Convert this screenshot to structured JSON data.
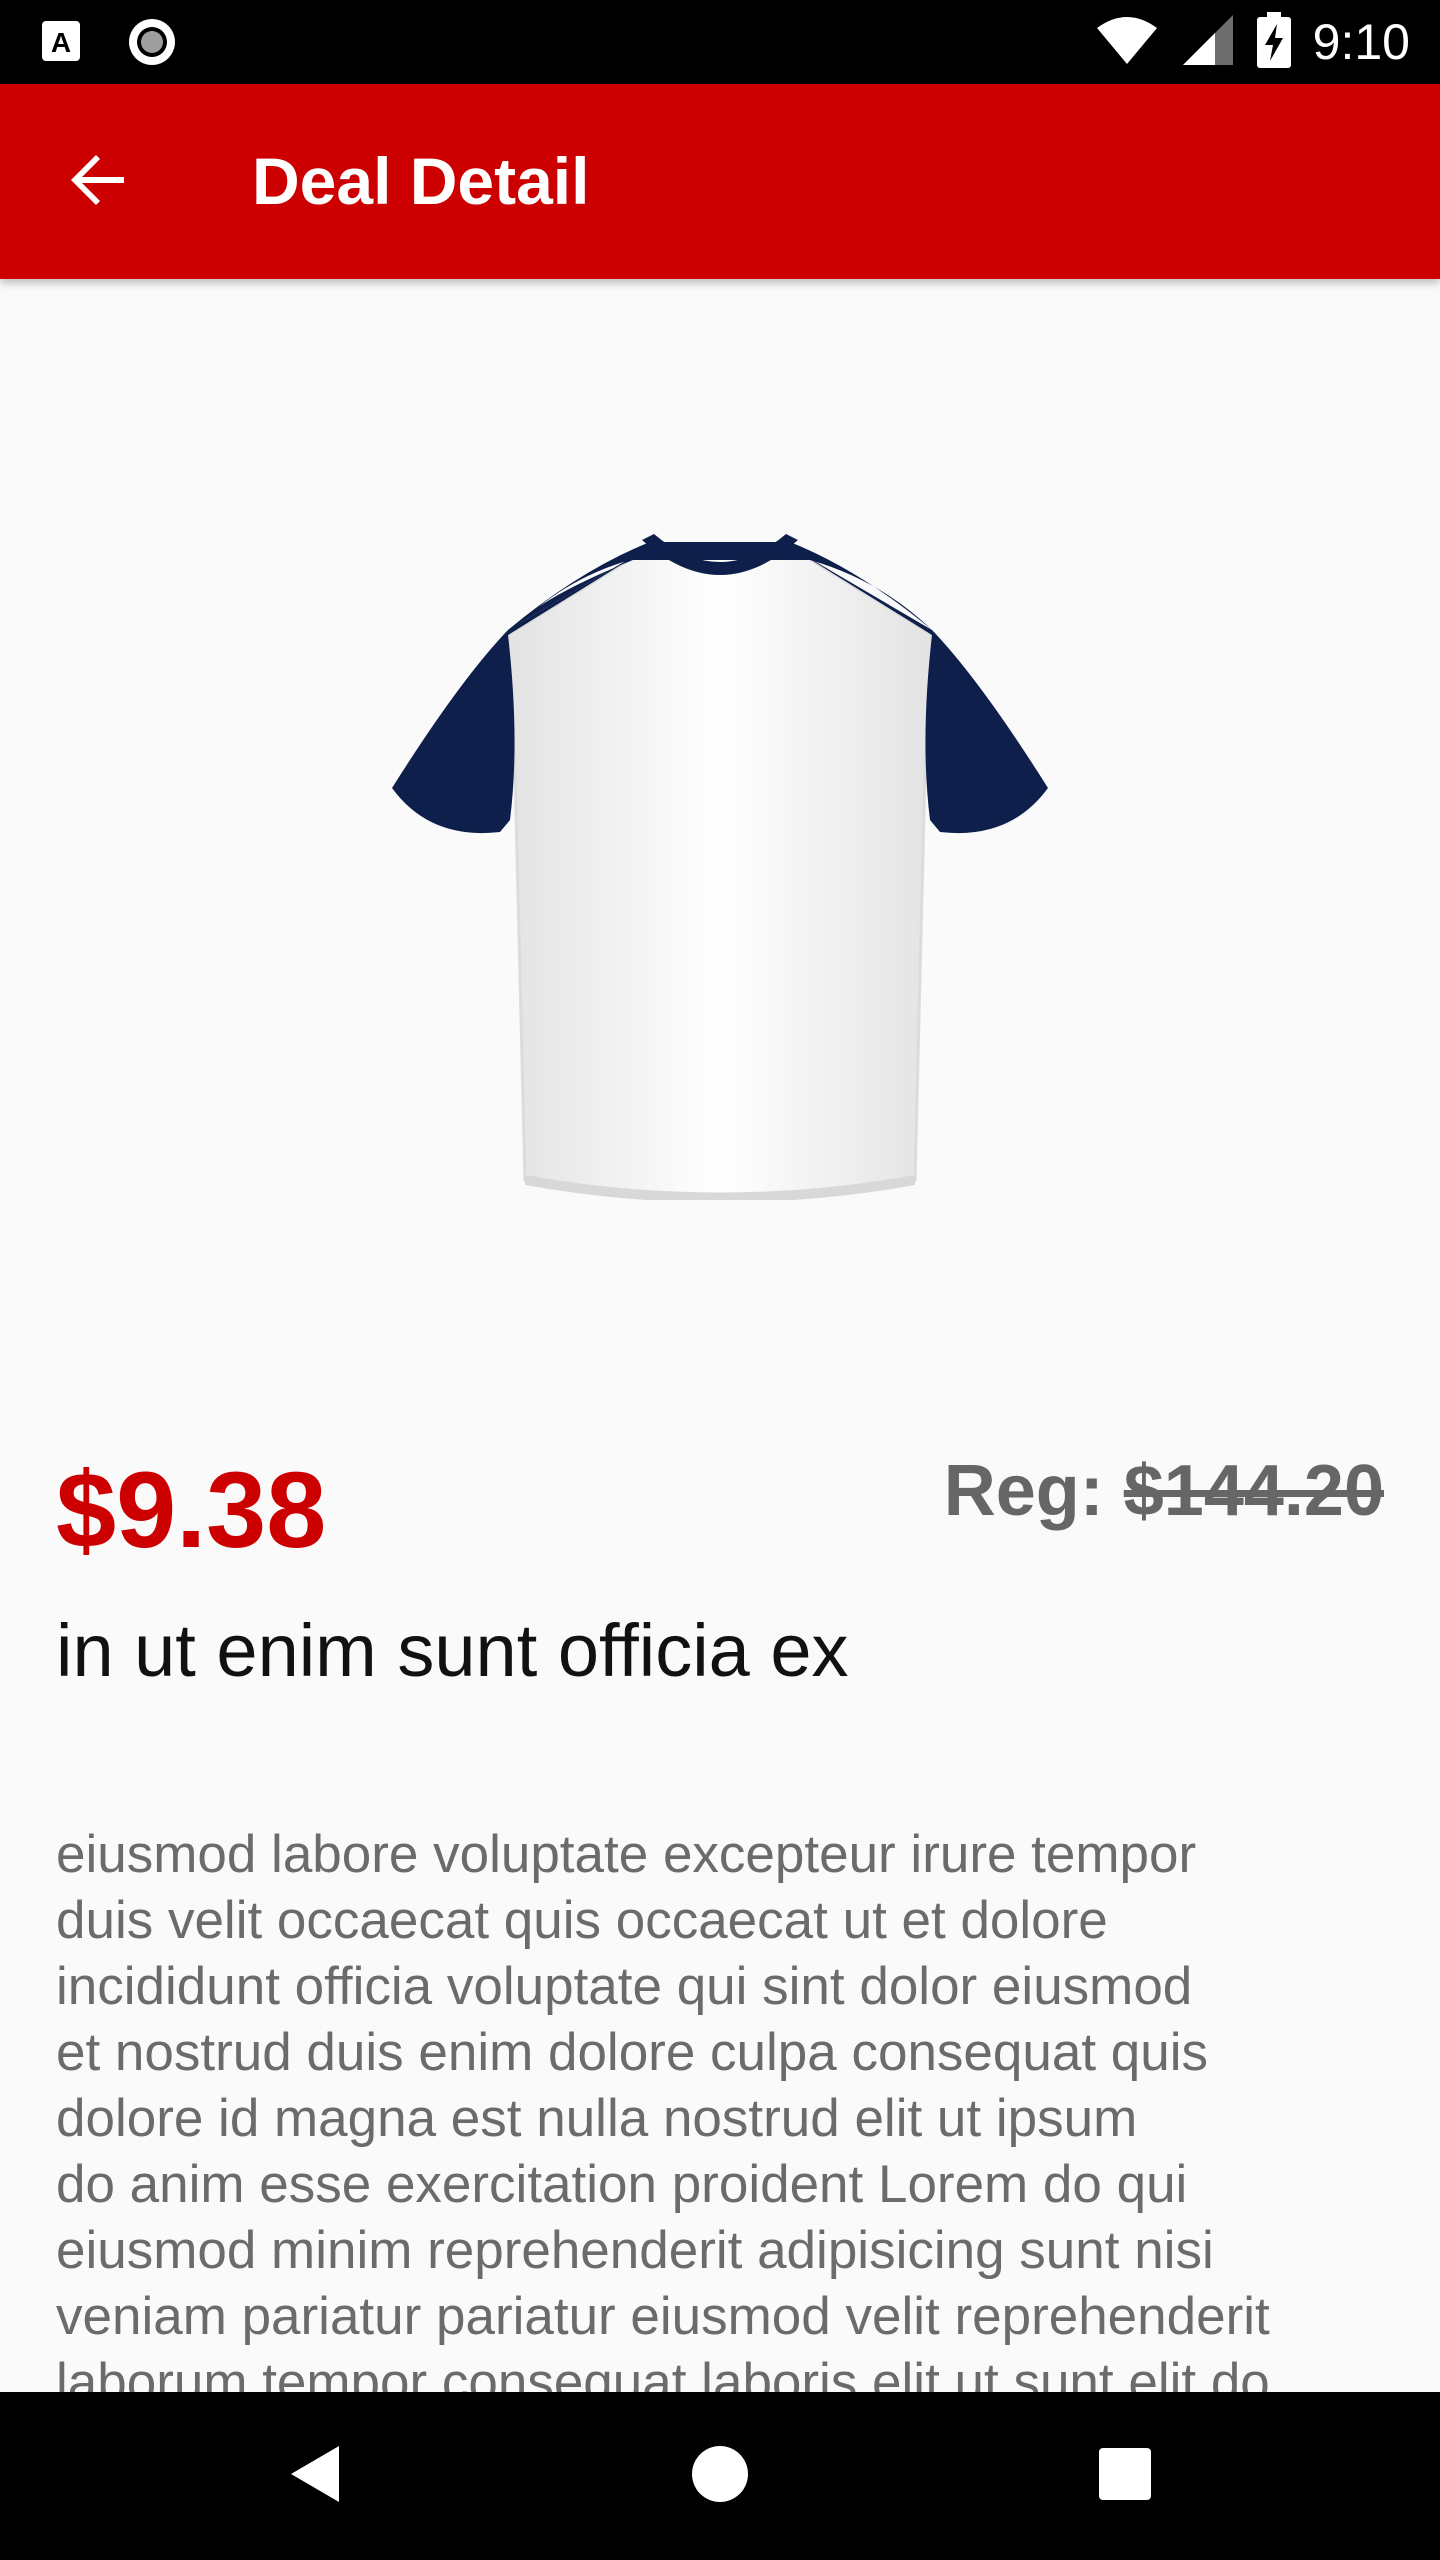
{
  "status_bar": {
    "time": "9:10",
    "icons": [
      "a-notification-icon",
      "circle-notification-icon",
      "wifi-icon",
      "cell-signal-icon",
      "battery-charging-icon"
    ]
  },
  "app_bar": {
    "title": "Deal Detail",
    "back_icon": "back-arrow-icon",
    "background": "#cc0000"
  },
  "product": {
    "image_icon": "t-shirt-image",
    "shirt_sleeve_color": "#0f1f4b",
    "price": "$9.38",
    "price_color": "#cc0000",
    "reg_label": "Reg: ",
    "reg_price": "$144.20",
    "title": "in ut enim sunt officia ex",
    "description_lines": [
      "eiusmod labore voluptate excepteur irure tempor",
      "duis velit occaecat quis occaecat ut et dolore",
      "incididunt officia voluptate qui sint dolor eiusmod",
      "et nostrud duis enim dolore culpa consequat quis",
      "dolore id magna est nulla nostrud elit ut ipsum",
      "do anim esse exercitation proident Lorem do qui",
      "eiusmod minim reprehenderit adipisicing sunt nisi",
      "veniam pariatur pariatur eiusmod velit reprehenderit",
      "laborum tempor consequat laboris elit ut sunt elit do"
    ]
  },
  "nav_bar": {
    "back_icon": "nav-back-icon",
    "home_icon": "nav-home-icon",
    "recents_icon": "nav-recents-icon"
  }
}
